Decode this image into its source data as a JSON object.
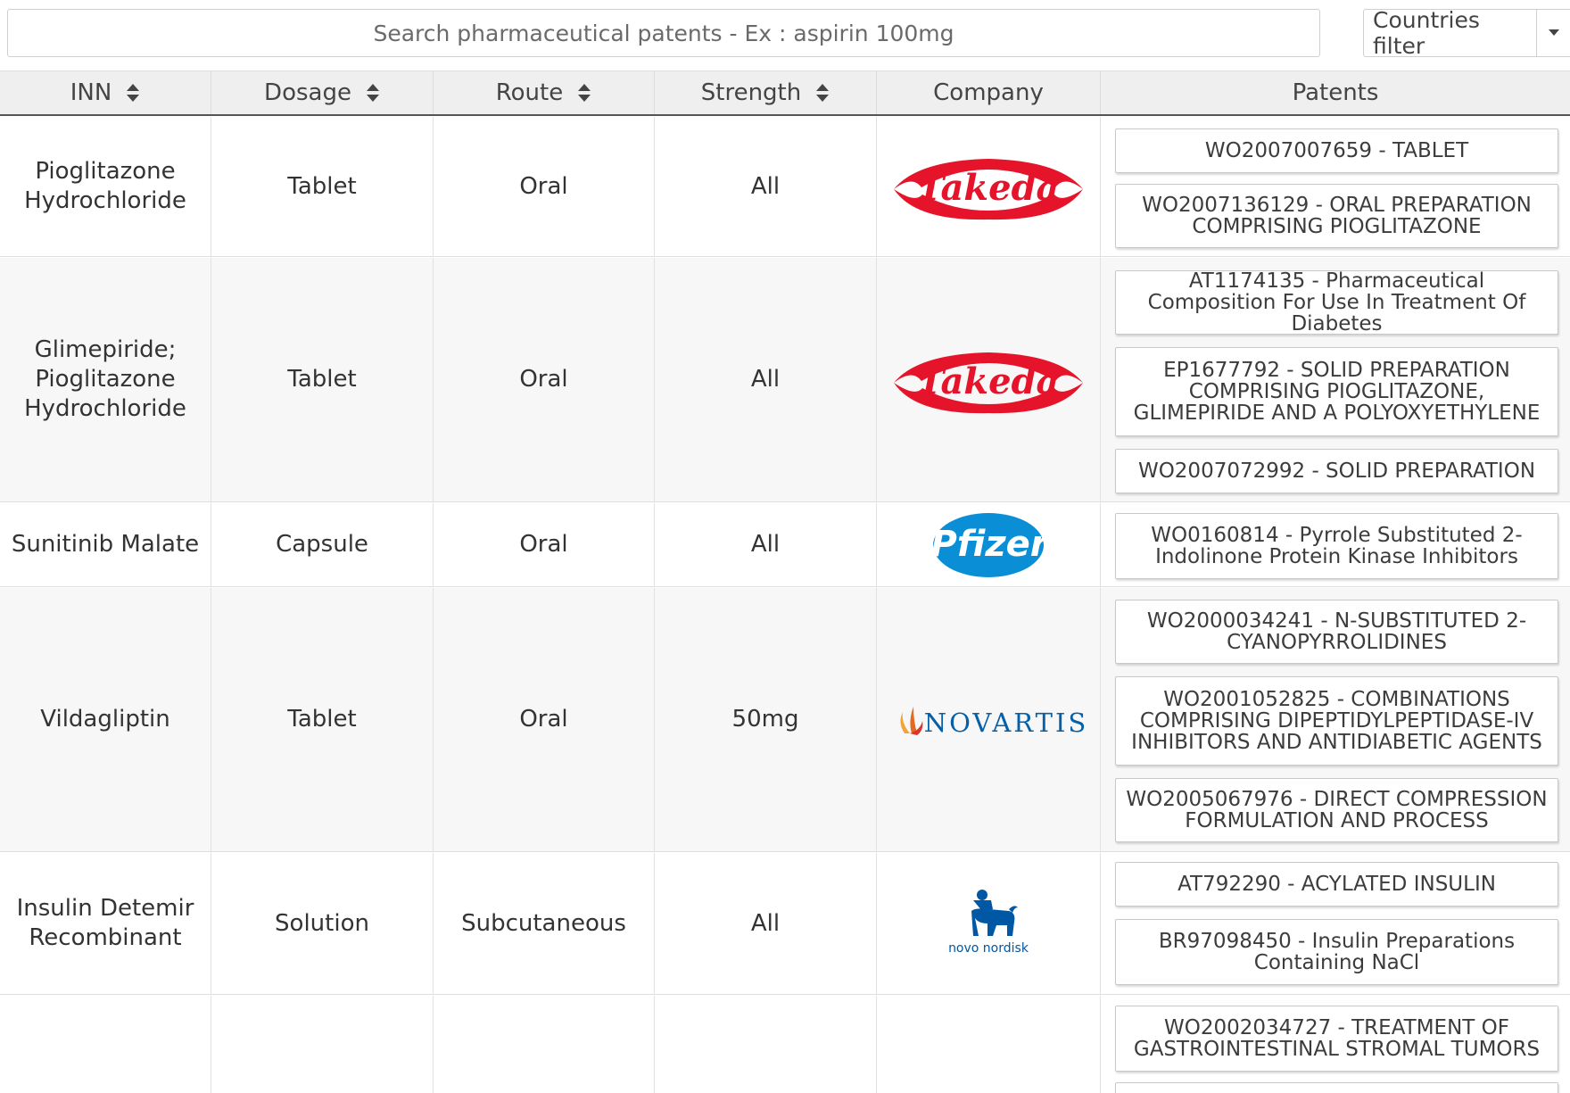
{
  "search": {
    "placeholder": "Search pharmaceutical patents - Ex : aspirin 100mg"
  },
  "filter": {
    "label": "Countries filter"
  },
  "table": {
    "headers": {
      "inn": "INN",
      "dosage": "Dosage",
      "route": "Route",
      "strength": "Strength",
      "company": "Company",
      "patents": "Patents"
    },
    "rows": [
      {
        "inn": "Pioglitazone Hydrochloride",
        "dosage": "Tablet",
        "route": "Oral",
        "strength": "All",
        "company": "Takeda",
        "patents": [
          "WO2007007659 - TABLET",
          "WO2007136129 - ORAL PREPARATION COMPRISING PIOGLITAZONE"
        ]
      },
      {
        "inn": "Glimepiride; Pioglitazone Hydrochloride",
        "dosage": "Tablet",
        "route": "Oral",
        "strength": "All",
        "company": "Takeda",
        "patents": [
          "AT1174135 - Pharmaceutical Composition For Use In Treatment Of Diabetes",
          "EP1677792 - SOLID PREPARATION COMPRISING PIOGLITAZONE, GLIMEPIRIDE AND A POLYOXYETHYLENE",
          "WO2007072992 - SOLID PREPARATION"
        ]
      },
      {
        "inn": "Sunitinib Malate",
        "dosage": "Capsule",
        "route": "Oral",
        "strength": "All",
        "company": "Pfizer",
        "patents": [
          "WO0160814 - Pyrrole Substituted 2-Indolinone Protein Kinase Inhibitors"
        ]
      },
      {
        "inn": "Vildagliptin",
        "dosage": "Tablet",
        "route": "Oral",
        "strength": "50mg",
        "company": "NOVARTIS",
        "patents": [
          "WO2000034241 - N-SUBSTITUTED 2-CYANOPYRROLIDINES",
          "WO2001052825 - COMBINATIONS COMPRISING DIPEPTIDYLPEPTIDASE-IV INHIBITORS AND ANTIDIABETIC AGENTS",
          "WO2005067976 - DIRECT COMPRESSION FORMULATION AND PROCESS"
        ]
      },
      {
        "inn": "Insulin Detemir Recombinant",
        "dosage": "Solution",
        "route": "Subcutaneous",
        "strength": "All",
        "company": "novo nordisk",
        "patents": [
          "AT792290 - ACYLATED INSULIN",
          "BR97098450 - Insulin Preparations Containing NaCl"
        ]
      },
      {
        "inn": "",
        "dosage": "",
        "route": "",
        "strength": "",
        "company": "",
        "patents": [
          "WO2002034727 - TREATMENT OF GASTROINTESTINAL STROMAL TUMORS"
        ]
      }
    ]
  },
  "colors": {
    "takeda_red": "#e5142a",
    "pfizer_blue": "#0a8fd6",
    "novartis_blue": "#0460a9",
    "novartis_orange": "#f2a33a",
    "novo_blue": "#0057a4",
    "header_bg": "#efefef",
    "row_alt_bg": "#f7f7f7"
  },
  "icons": {
    "sort": "sort-updown-icon",
    "dropdown": "caret-down-icon"
  }
}
